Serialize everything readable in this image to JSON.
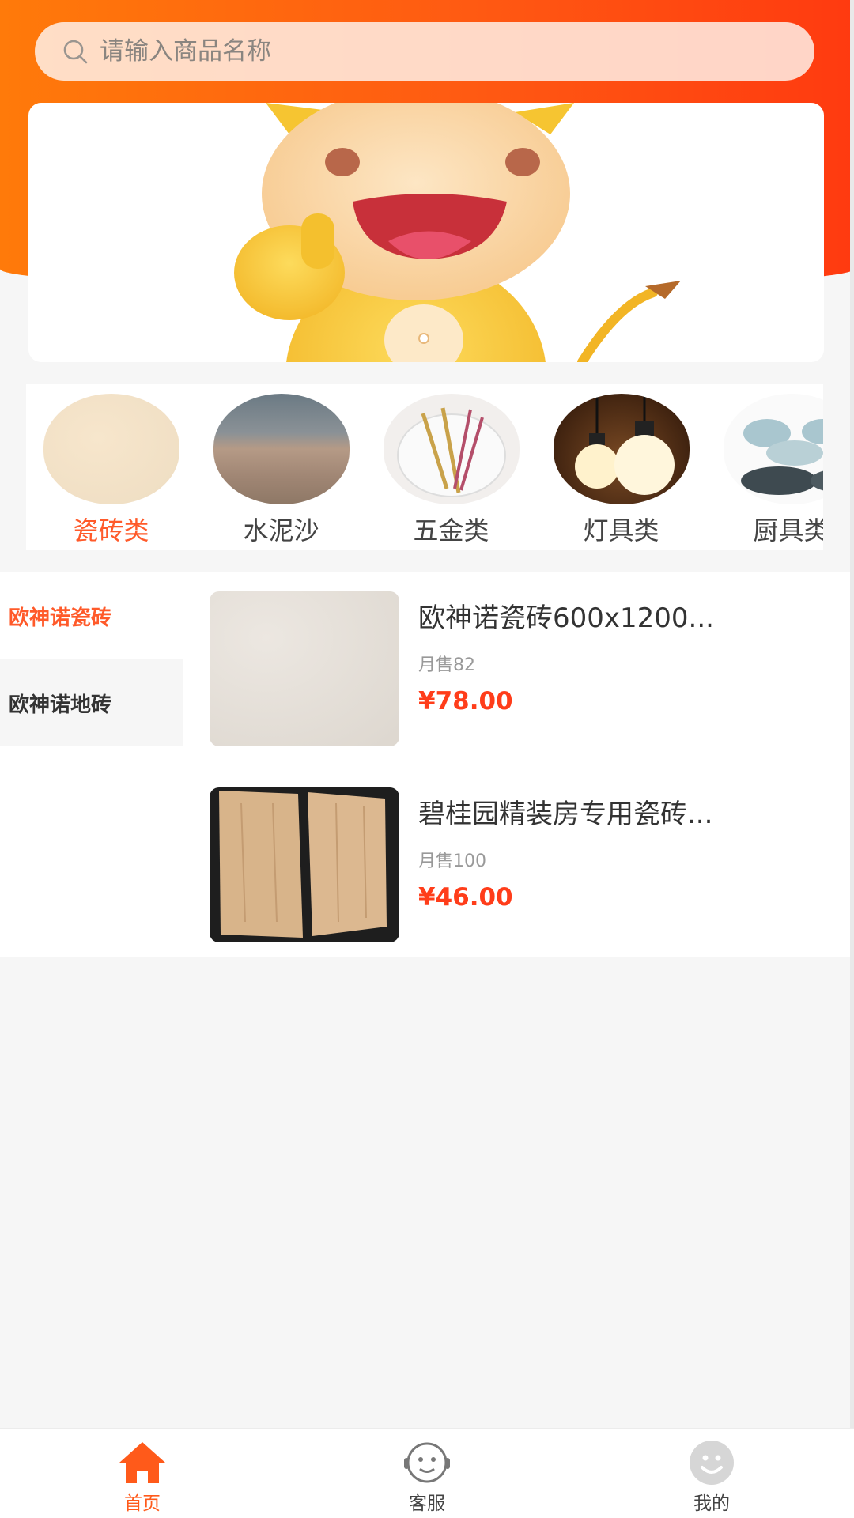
{
  "search": {
    "placeholder": "请输入商品名称"
  },
  "categories": [
    {
      "label": "瓷砖类",
      "active": true
    },
    {
      "label": "水泥沙",
      "active": false
    },
    {
      "label": "五金类",
      "active": false
    },
    {
      "label": "灯具类",
      "active": false
    },
    {
      "label": "厨具类",
      "active": false
    }
  ],
  "sidebar": {
    "items": [
      {
        "label": "欧神诺瓷砖",
        "active": true
      },
      {
        "label": "欧神诺地砖",
        "active": false
      }
    ]
  },
  "products": [
    {
      "name": "欧神诺瓷砖600x1200...",
      "sales": "月售82",
      "price": "¥78.00"
    },
    {
      "name": "碧桂园精装房专用瓷砖...",
      "sales": "月售100",
      "price": "¥46.00"
    }
  ],
  "tabbar": {
    "items": [
      {
        "label": "首页",
        "icon": "home-icon",
        "active": true
      },
      {
        "label": "客服",
        "icon": "customer-service-icon",
        "active": false
      },
      {
        "label": "我的",
        "icon": "profile-icon",
        "active": false
      }
    ]
  },
  "colors": {
    "brand": "#ff5a12",
    "accent_text": "#ff5a2a",
    "price": "#ff3d1a"
  }
}
